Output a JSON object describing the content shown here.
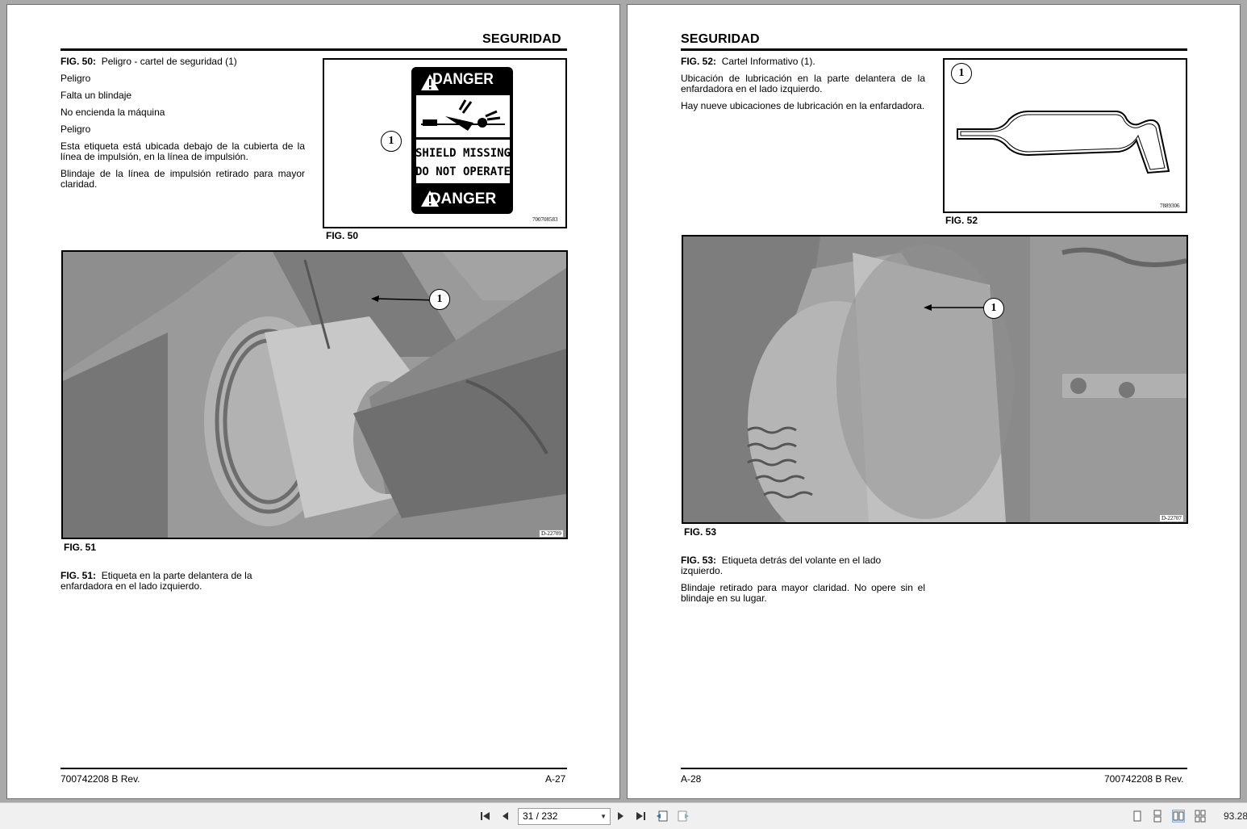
{
  "left_page": {
    "header": "SEGURIDAD",
    "fig50_ref": "FIG. 50:",
    "fig50_title": "Peligro - cartel de seguridad (1)",
    "lines": [
      "Peligro",
      "Falta un blindaje",
      "No encienda la máquina",
      "Peligro"
    ],
    "para1": "Esta etiqueta está ubicada debajo de la cubierta de la línea de impulsión, en la línea de impulsión.",
    "para2": "Blindaje de la línea de impulsión retirado para mayor claridad.",
    "fig50_caption": "FIG. 50",
    "fig50_code": "700708583",
    "fig50_callout": "1",
    "sign": {
      "top_word": "DANGER",
      "line1": "SHIELD MISSING",
      "line2": "DO NOT OPERATE",
      "bottom_word": "DANGER"
    },
    "fig51_caption": "FIG. 51",
    "fig51_code": "D-22709",
    "fig51_callout": "1",
    "fig51_ref": "FIG. 51:",
    "fig51_text": "Etiqueta en la parte delantera de la enfardadora en el lado izquierdo.",
    "footer_left": "700742208 B Rev.",
    "footer_right": "A-27"
  },
  "right_page": {
    "header": "SEGURIDAD",
    "fig52_ref": "FIG. 52:",
    "fig52_title": "Cartel Informativo (1).",
    "para1": "Ubicación de lubricación en la parte delantera de la enfardadora en el lado izquierdo.",
    "para2": "Hay nueve ubicaciones de lubricación en la enfardadora.",
    "fig52_caption": "FIG. 52",
    "fig52_code": "7889306",
    "fig52_callout": "1",
    "fig53_caption": "FIG. 53",
    "fig53_code": "D-22707",
    "fig53_callout": "1",
    "fig53_ref": "FIG. 53:",
    "fig53_text": "Etiqueta detrás del volante en el lado izquierdo.",
    "fig53_para2": "Blindaje retirado para mayor claridad. No opere sin el blindaje en su lugar.",
    "footer_left": "A-28",
    "footer_right": "700742208 B Rev."
  },
  "toolbar": {
    "page_indicator": "31 / 232",
    "zoom": "93.28",
    "icons": [
      "first-page-icon",
      "prev-page-icon",
      "next-page-icon",
      "last-page-icon",
      "prev-view-icon",
      "next-view-icon",
      "single-page-view-icon",
      "continuous-view-icon",
      "two-page-view-icon",
      "two-page-continuous-view-icon"
    ]
  }
}
